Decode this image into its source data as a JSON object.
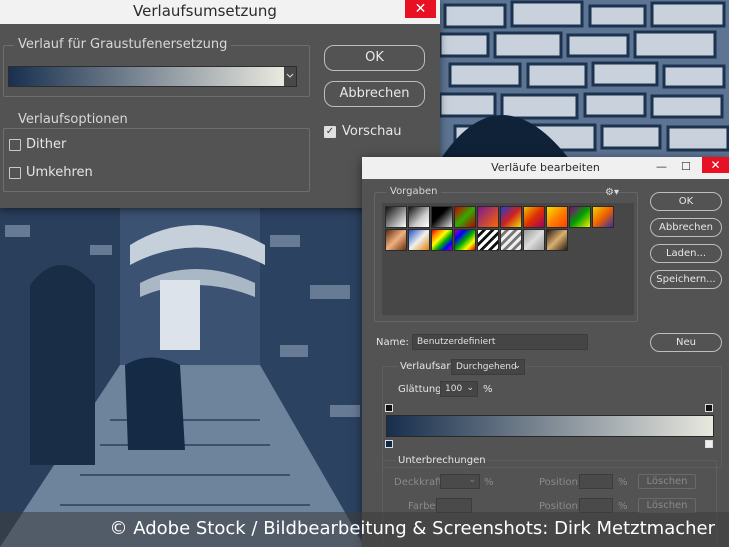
{
  "dialog1": {
    "title": "Verlaufsumsetzung",
    "close": "✕",
    "gradient_group_label": "Verlauf für Graustufenersetzung",
    "ok_label": "OK",
    "cancel_label": "Abbrechen",
    "preview_label": "Vorschau",
    "preview_checked": true,
    "options_group_label": "Verlaufsoptionen",
    "dither_label": "Dither",
    "reverse_label": "Umkehren",
    "gradient_colors": [
      "#18304f",
      "#e9e9df"
    ]
  },
  "dialog2": {
    "title": "Verläufe bearbeiten",
    "minimize": "—",
    "maximize": "☐",
    "close": "✕",
    "presets_label": "Vorgaben",
    "ok_label": "OK",
    "cancel_label": "Abbrechen",
    "load_label": "Laden...",
    "save_label": "Speichern...",
    "name_label": "Name:",
    "name_value": "Benutzerdefiniert",
    "new_label": "Neu",
    "type_label": "Verlaufsart:",
    "type_value": "Durchgehend",
    "smoothness_label": "Glättung:",
    "smoothness_value": "100",
    "smoothness_unit": "%",
    "stops_label": "Unterbrechungen",
    "opacity_label": "Deckkraft:",
    "opacity_unit": "%",
    "position_label": "Position:",
    "position_unit": "%",
    "delete_label": "Löschen",
    "color_label": "Farbe:",
    "position2_label": "Position:",
    "position2_unit": "%",
    "delete2_label": "Löschen",
    "gradient_colors": [
      "#172e4c",
      "#e8e8df"
    ]
  },
  "credit": "© Adobe Stock / Bildbearbeitung & Screenshots: Dirk Metztmacher"
}
